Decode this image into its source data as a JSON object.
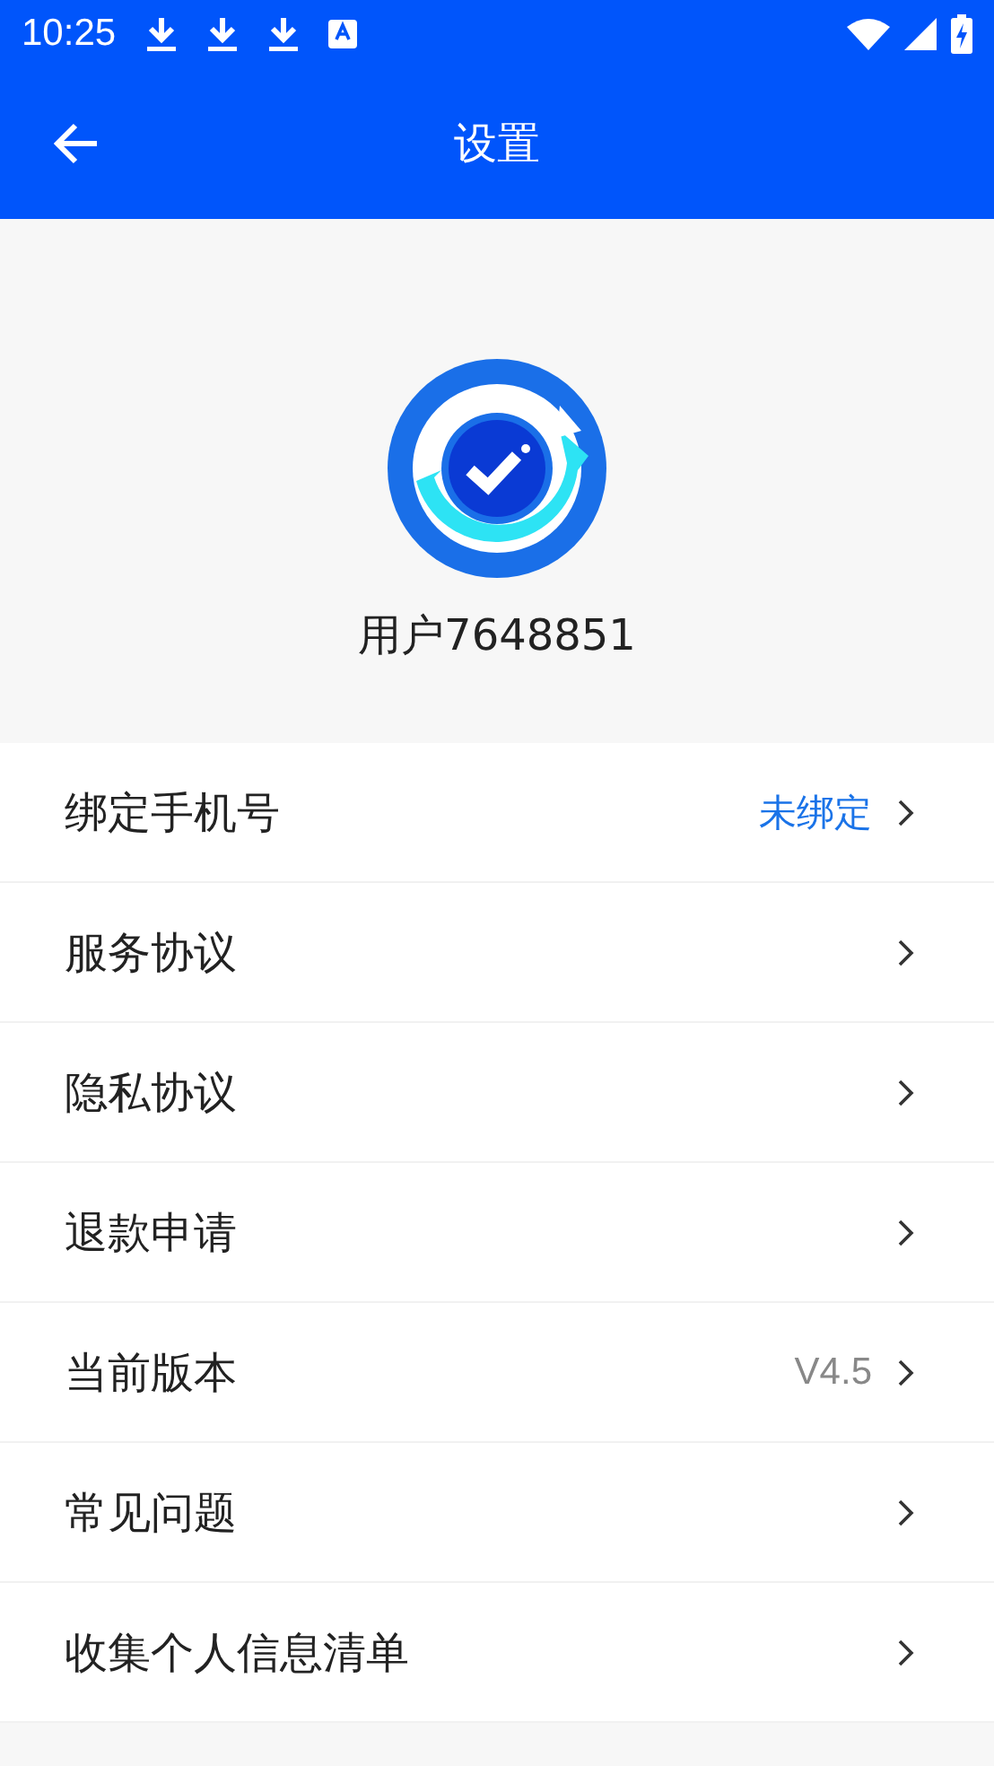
{
  "status_bar": {
    "time": "10:25",
    "notifications": [
      {
        "kind": "download"
      },
      {
        "kind": "download"
      },
      {
        "kind": "download"
      },
      {
        "kind": "keyboard"
      }
    ]
  },
  "app_bar": {
    "title": "设置"
  },
  "profile": {
    "username": "用户7648851"
  },
  "settings": [
    {
      "label": "绑定手机号",
      "kind": "link",
      "value": "未绑定"
    },
    {
      "label": "服务协议",
      "kind": "plain"
    },
    {
      "label": "隐私协议",
      "kind": "plain"
    },
    {
      "label": "退款申请",
      "kind": "plain"
    },
    {
      "label": "当前版本",
      "kind": "info",
      "value": "V4.5"
    },
    {
      "label": "常见问题",
      "kind": "plain"
    },
    {
      "label": "收集个人信息清单",
      "kind": "plain"
    }
  ]
}
